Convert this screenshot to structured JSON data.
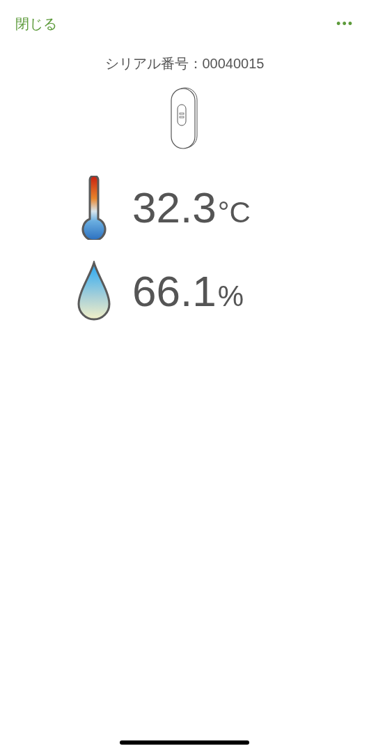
{
  "header": {
    "close": "閉じる",
    "more": "•••"
  },
  "serial": "シリアル番号：00040015",
  "readings": [
    {
      "kind": "temperature",
      "value": "32.3",
      "unit": "°C"
    },
    {
      "kind": "humidity",
      "value": "66.1",
      "unit": "%"
    }
  ]
}
